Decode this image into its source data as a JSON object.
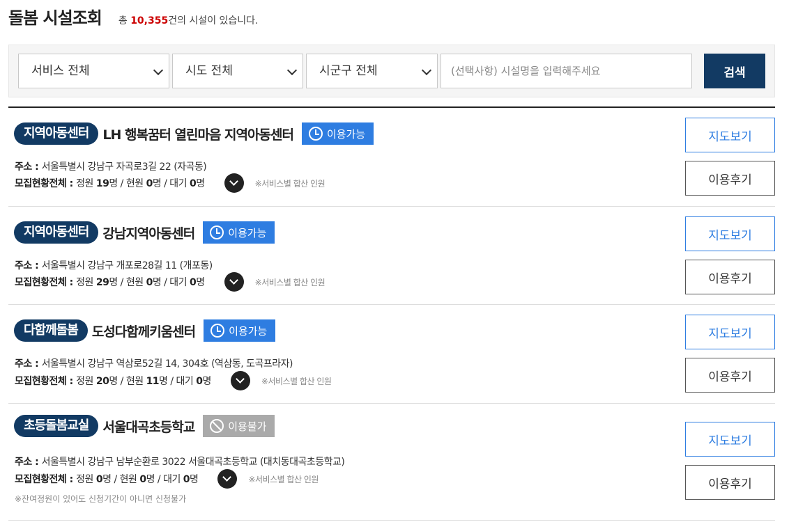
{
  "header": {
    "title": "돌봄 시설조회",
    "total_prefix": "총 ",
    "total_count": "10,355",
    "total_suffix": "건의 시설이 있습니다."
  },
  "search": {
    "service_select": "서비스 전체",
    "sido_select": "시도 전체",
    "sigungu_select": "시군구 전체",
    "placeholder": "(선택사항) 시설명을 입력해주세요",
    "button": "검색"
  },
  "facilities": [
    {
      "tag": "지역아동센터",
      "name": "LH 행복꿈터 열린마음 지역아동센터",
      "status": "이용가능",
      "addr_label": "주소 : ",
      "address": "서울특별시 강남구 자곡로3길 22 (자곡동)",
      "stat_label": "모집현황전체 : ",
      "quota_label": "정원 ",
      "quota": "19",
      "cur_label": "명 / 현원 ",
      "current": "0",
      "wait_label": "명 / 대기 ",
      "waiting": "0",
      "unit": "명",
      "note": "※서비스별 합산 인원",
      "map_btn": "지도보기",
      "review_btn": "이용후기"
    },
    {
      "tag": "지역아동센터",
      "name": "강남지역아동센터",
      "status": "이용가능",
      "addr_label": "주소 : ",
      "address": "서울특별시 강남구 개포로28길 11 (개포동)",
      "stat_label": "모집현황전체 : ",
      "quota_label": "정원 ",
      "quota": "29",
      "cur_label": "명 / 현원 ",
      "current": "0",
      "wait_label": "명 / 대기 ",
      "waiting": "0",
      "unit": "명",
      "note": "※서비스별 합산 인원",
      "map_btn": "지도보기",
      "review_btn": "이용후기"
    },
    {
      "tag": "다함께돌봄",
      "name": "도성다함께키움센터",
      "status": "이용가능",
      "addr_label": "주소 : ",
      "address": "서울특별시 강남구 역삼로52길 14, 304호 (역삼동, 도곡프라자)",
      "stat_label": "모집현황전체 : ",
      "quota_label": "정원 ",
      "quota": "20",
      "cur_label": "명 / 현원 ",
      "current": "11",
      "wait_label": "명 / 대기 ",
      "waiting": "0",
      "unit": "명",
      "note": "※서비스별 합산 인원",
      "map_btn": "지도보기",
      "review_btn": "이용후기"
    },
    {
      "tag": "초등돌봄교실",
      "name": "서울대곡초등학교",
      "status": "이용불가",
      "addr_label": "주소 : ",
      "address": "서울특별시 강남구 남부순환로 3022 서울대곡초등학교 (대치동대곡초등학교)",
      "stat_label": "모집현황전체 : ",
      "quota_label": "정원 ",
      "quota": "0",
      "cur_label": "명 / 현원 ",
      "current": "0",
      "wait_label": "명 / 대기 ",
      "waiting": "0",
      "unit": "명",
      "note": "※서비스별 합산 인원",
      "extra_note": "※잔여정원이 있어도 신청기간이 아니면 신청불가",
      "map_btn": "지도보기",
      "review_btn": "이용후기"
    }
  ],
  "colors": {
    "navy": "#123a63",
    "available": "#2e7de1",
    "unavailable": "#aaaaaa",
    "count_red": "#cc0000"
  }
}
